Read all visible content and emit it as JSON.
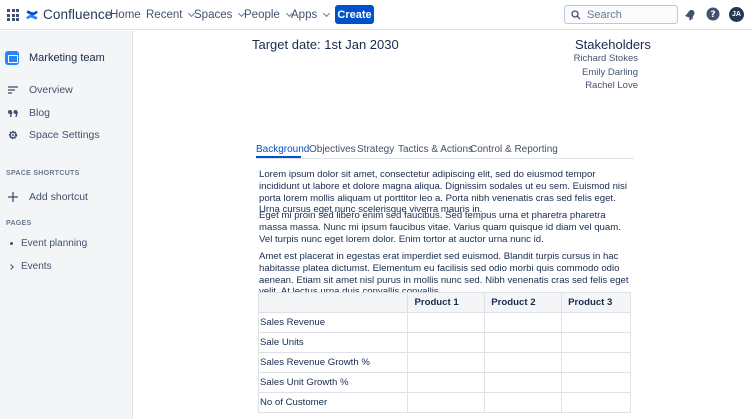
{
  "topnav": {
    "brand": "Confluence",
    "items": [
      {
        "label": "Home",
        "dropdown": false
      },
      {
        "label": "Recent",
        "dropdown": true
      },
      {
        "label": "Spaces",
        "dropdown": true
      },
      {
        "label": "People",
        "dropdown": true
      },
      {
        "label": "Apps",
        "dropdown": true
      }
    ],
    "create_label": "Create",
    "search_placeholder": "Search",
    "avatar_initials": "JA",
    "icons": [
      "app-switcher-icon",
      "confluence-logo-icon",
      "search-icon",
      "notification-icon",
      "help-icon"
    ]
  },
  "sidebar": {
    "space_name": "Marketing team",
    "items": [
      {
        "label": "Overview",
        "icon": "overview-icon"
      },
      {
        "label": "Blog",
        "icon": "quote-icon"
      },
      {
        "label": "Space Settings",
        "icon": "gear-icon"
      }
    ],
    "shortcuts_header": "SPACE SHORTCUTS",
    "add_shortcut": "Add shortcut",
    "pages_header": "PAGES",
    "pages": [
      {
        "label": "Event planning",
        "marker": "bullet"
      },
      {
        "label": "Events",
        "marker": "chevron"
      }
    ]
  },
  "page": {
    "target_date": "Target date: 1st Jan 2030",
    "stakeholders_title": "Stakeholders",
    "stakeholders": [
      "Richard Stokes",
      "Emily Darling",
      "Rachel Love"
    ],
    "tabs": [
      {
        "label": "Background",
        "active": true
      },
      {
        "label": "Objectives",
        "active": false
      },
      {
        "label": "Strategy",
        "active": false
      },
      {
        "label": "Tactics & Actions",
        "active": false
      },
      {
        "label": "Control & Reporting",
        "active": false
      }
    ],
    "paragraphs": [
      "Lorem ipsum dolor sit amet, consectetur adipiscing elit, sed do eiusmod tempor incididunt ut labore et dolore magna aliqua. Dignissim sodales ut eu sem. Euismod nisi porta lorem mollis aliquam ut porttitor leo a. Porta nibh venenatis cras sed felis eget. Urna cursus eget nunc scelerisque viverra mauris in.",
      "Eget mi proin sed libero enim sed faucibus. Sed tempus urna et pharetra pharetra massa massa. Nunc mi ipsum faucibus vitae. Varius quam quisque id diam vel quam. Vel turpis nunc eget lorem dolor. Enim tortor at auctor urna nunc id.",
      "Amet est placerat in egestas erat imperdiet sed euismod. Blandit turpis cursus in hac habitasse platea dictumst. Elementum eu facilisis sed odio morbi quis commodo odio aenean. Etiam sit amet nisl purus in mollis nunc sed. Nibh venenatis cras sed felis eget velit. At lectus urna duis convallis convallis."
    ],
    "table": {
      "headers": [
        "",
        "Product 1",
        "Product 2",
        "Product 3"
      ],
      "rows": [
        "Sales Revenue",
        "Sale Units",
        "Sales Revenue Growth %",
        "Sales Unit Growth %",
        "No of Customer"
      ]
    }
  },
  "colors": {
    "brand_blue": "#0052cc",
    "text_primary": "#172b4d",
    "text_secondary": "#42526e",
    "sidebar_bg": "#f4f5f7",
    "border": "#dfe1e6"
  }
}
